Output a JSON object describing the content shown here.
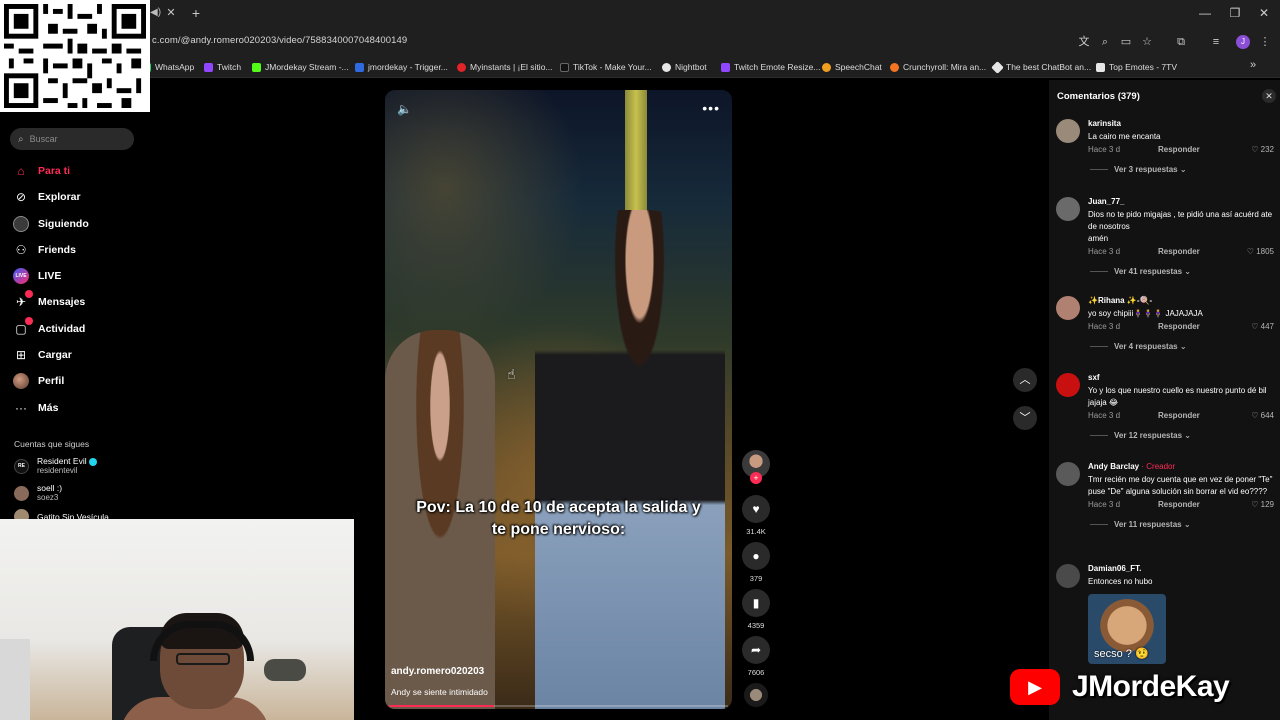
{
  "browser": {
    "url": "c.com/@andy.romero020203/video/7588340007048400149",
    "bookmarks": [
      {
        "label": "WhatsApp",
        "color": "#25d366"
      },
      {
        "label": "Twitch",
        "color": "#9146ff"
      },
      {
        "label": "JMordekay Stream -...",
        "color": "#53fc18"
      },
      {
        "label": "jmordekay - Trigger...",
        "color": "#2f6ae0"
      },
      {
        "label": "Myinstants | ¡El sitio...",
        "color": "#e0242a"
      },
      {
        "label": "TikTok - Make Your...",
        "color": "#111111"
      },
      {
        "label": "Nightbot",
        "color": "#e6e6e6"
      },
      {
        "label": "Twitch Emote Resize...",
        "color": "#9146ff"
      },
      {
        "label": "SpeechChat",
        "color": "#f0a020"
      },
      {
        "label": "Crunchyroll: Mira an...",
        "color": "#f47521"
      },
      {
        "label": "The best ChatBot an...",
        "color": "#e6e6e6"
      },
      {
        "label": "Top Emotes - 7TV",
        "color": "#e6e6e6"
      }
    ],
    "profile_initial": "J"
  },
  "sidebar": {
    "search_placeholder": "Buscar",
    "nav": [
      {
        "label": "Para ti",
        "icon": "home-icon"
      },
      {
        "label": "Explorar",
        "icon": "compass-icon"
      },
      {
        "label": "Siguiendo",
        "icon": "following-icon"
      },
      {
        "label": "Friends",
        "icon": "friends-icon"
      },
      {
        "label": "LIVE",
        "icon": "live-icon"
      },
      {
        "label": "Mensajes",
        "icon": "messages-icon"
      },
      {
        "label": "Actividad",
        "icon": "activity-icon"
      },
      {
        "label": "Cargar",
        "icon": "upload-icon"
      },
      {
        "label": "Perfil",
        "icon": "profile-icon"
      },
      {
        "label": "Más",
        "icon": "more-icon"
      }
    ],
    "following_title": "Cuentas que sigues",
    "accounts": [
      {
        "name": "Resident Evil",
        "handle": "residentevil",
        "verified": true
      },
      {
        "name": "soell :)",
        "handle": "soez3",
        "verified": false
      },
      {
        "name": "Gatito Sin Vesícula",
        "handle": "",
        "verified": false
      }
    ]
  },
  "video": {
    "caption": "Pov: La 10 de 10 de acepta la salida y te pone nervioso:",
    "author": "andy.romero020203",
    "description": "Andy se siente intimidado",
    "progress": 0.31
  },
  "actions": {
    "likes": "31.4K",
    "comments": "379",
    "saves": "4359",
    "shares": "7606"
  },
  "comments_panel": {
    "title": "Comentarios (379)",
    "items": [
      {
        "user": "karinsita",
        "creator": "",
        "text": "La cairo me encanta",
        "time": "Hace 3 d",
        "reply": "Responder",
        "likes": "232",
        "more": "Ver 3 respuestas",
        "avatar": "#9a8a7a"
      },
      {
        "user": "Juan_77_",
        "creator": "",
        "text": "Dios no te pido migajas , te pidió una así acuérd ate de nosotros\namén",
        "time": "Hace 3 d",
        "reply": "Responder",
        "likes": "1805",
        "more": "Ver 41 respuestas",
        "avatar": "#6a6a6a"
      },
      {
        "user": "✨Rihana ✨-🍭-",
        "creator": "",
        "text": "yo soy chipiii🧍‍♀️🧍‍♀️🧍‍♀️ JAJAJAJA",
        "time": "Hace 3 d",
        "reply": "Responder",
        "likes": "447",
        "more": "Ver 4 respuestas",
        "avatar": "#b08070"
      },
      {
        "user": "sxf",
        "creator": "",
        "text": "Yo y los que nuestro cuello es nuestro punto dé bil jajaja 😂",
        "time": "Hace 3 d",
        "reply": "Responder",
        "likes": "644",
        "more": "Ver 12 respuestas",
        "avatar": "#c81010"
      },
      {
        "user": "Andy Barclay",
        "creator": "· Creador",
        "text": "Tmr recién me doy cuenta que en vez de poner \"Te\" puse \"De\" alguna solución sin borrar el vid eo????",
        "time": "Hace 3 d",
        "reply": "Responder",
        "likes": "129",
        "more": "Ver 11 respuestas",
        "avatar": "#5a5a5a"
      },
      {
        "user": "Damian06_FT.",
        "creator": "",
        "text": "Entonces no hubo",
        "time": "",
        "reply": "",
        "likes": "",
        "more": "",
        "avatar": "#4a4a4a",
        "sticker_text": "secso ? 🤨"
      }
    ]
  },
  "overlay": {
    "channel_name": "JMordeKay"
  }
}
